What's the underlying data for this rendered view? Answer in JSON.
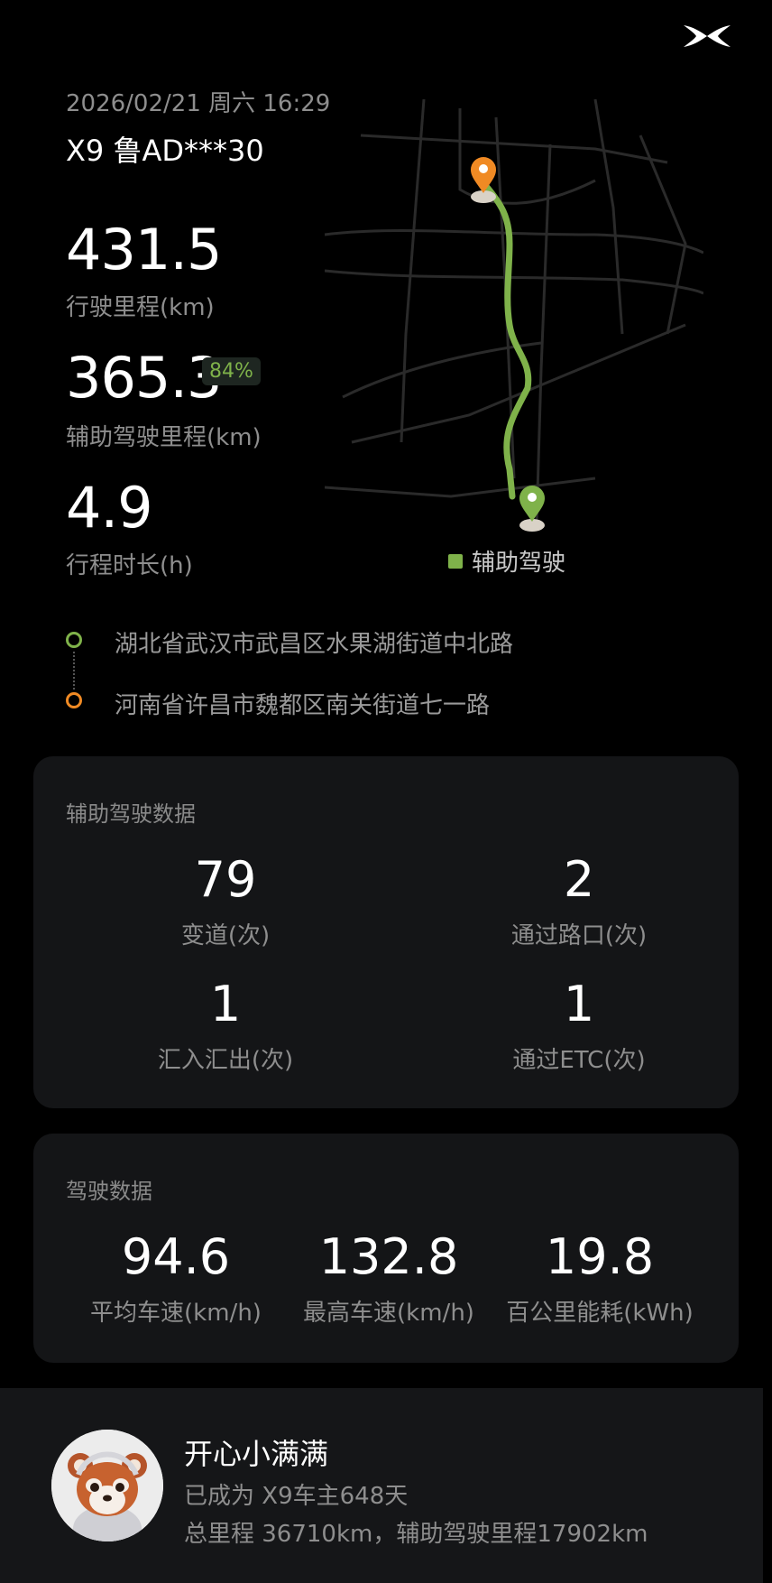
{
  "header": {
    "datetime": "2026/02/21 周六 16:29",
    "vehicle_plate": "X9 鲁AD***30",
    "logo_icon": "xpeng-logo-icon"
  },
  "trip": {
    "distance_value": "431.5",
    "distance_label": "行驶里程(km)",
    "assist_distance_value": "365.3",
    "assist_percent": "84%",
    "assist_distance_label": "辅助驾驶里程(km)",
    "duration_value": "4.9",
    "duration_label": "行程时长(h)"
  },
  "map": {
    "legend_label": "辅助驾驶",
    "route_color": "#7fb24a",
    "end_color": "#f08a24"
  },
  "route": {
    "start": "湖北省武汉市武昌区水果湖街道中北路",
    "end": "河南省许昌市魏都区南关街道七一路"
  },
  "assist_card": {
    "title": "辅助驾驶数据",
    "stats": [
      {
        "value": "79",
        "label": "变道(次)"
      },
      {
        "value": "2",
        "label": "通过路口(次)"
      },
      {
        "value": "1",
        "label": "汇入汇出(次)"
      },
      {
        "value": "1",
        "label": "通过ETC(次)"
      }
    ]
  },
  "drive_card": {
    "title": "驾驶数据",
    "stats": [
      {
        "value": "94.6",
        "label": "平均车速(km/h)"
      },
      {
        "value": "132.8",
        "label": "最高车速(km/h)"
      },
      {
        "value": "19.8",
        "label": "百公里能耗(kWh)"
      }
    ]
  },
  "user": {
    "name": "开心小满满",
    "owner_days": "已成为 X9车主648天",
    "totals": "总里程 36710km，辅助驾驶里程17902km"
  }
}
